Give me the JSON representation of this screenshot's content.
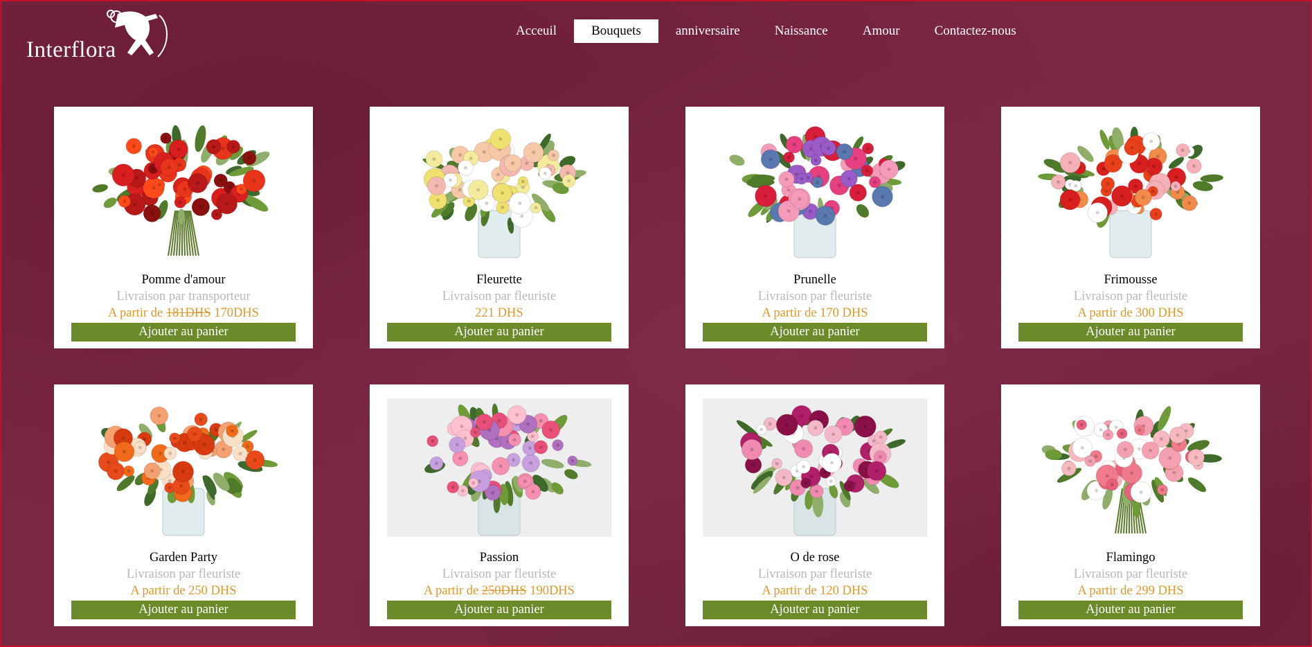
{
  "brand": {
    "logo_text": "Interflora"
  },
  "nav": {
    "items": [
      {
        "label": "Acceuil",
        "active": false
      },
      {
        "label": "Bouquets",
        "active": true
      },
      {
        "label": "anniversaire",
        "active": false
      },
      {
        "label": "Naissance",
        "active": false
      },
      {
        "label": "Amour",
        "active": false
      },
      {
        "label": "Contactez-nous",
        "active": false
      }
    ]
  },
  "colors": {
    "background": "#7a2743",
    "button": "#6b8a2a",
    "price": "#e0982a",
    "delivery": "#b8b8b8"
  },
  "products": [
    {
      "name": "Pomme d'amour",
      "delivery": "Livraison par transporteur",
      "price_prefix": "A partir de",
      "old_price": "181DHS",
      "price": "170DHS",
      "button": "Ajouter au panier",
      "palette": [
        "#d81e1e",
        "#e8341a",
        "#b81818",
        "#ff4a1a",
        "#8a1010"
      ],
      "vase": false
    },
    {
      "name": "Fleurette",
      "delivery": "Livraison par fleuriste",
      "price_prefix": "",
      "old_price": "",
      "price": "221 DHS",
      "button": "Ajouter au panier",
      "palette": [
        "#f4ec9c",
        "#f7c8a8",
        "#f0e070",
        "#ffffff",
        "#f5b8b0"
      ],
      "vase": true
    },
    {
      "name": "Prunelle",
      "delivery": "Livraison par fleuriste",
      "price_prefix": "A partir de",
      "old_price": "",
      "price": "170 DHS",
      "button": "Ajouter au panier",
      "palette": [
        "#e64080",
        "#9a5ac8",
        "#d81e3a",
        "#f59ab8",
        "#5a78b0"
      ],
      "vase": true
    },
    {
      "name": "Frimousse",
      "delivery": "Livraison par fleuriste",
      "price_prefix": "A partir de",
      "old_price": "",
      "price": "300 DHS",
      "button": "Ajouter au panier",
      "palette": [
        "#d81e1e",
        "#f28a4a",
        "#f5b0b8",
        "#e8401a",
        "#ffffff"
      ],
      "vase": true
    },
    {
      "name": "Garden Party",
      "delivery": "Livraison par fleuriste",
      "price_prefix": "A partir de",
      "old_price": "",
      "price": "250 DHS",
      "button": "Ajouter au panier",
      "palette": [
        "#f06a1a",
        "#f5a070",
        "#e84a1a",
        "#fbe0c8",
        "#d83a10"
      ],
      "vase": true
    },
    {
      "name": "Passion",
      "delivery": "Livraison par fleuriste",
      "price_prefix": "A partir de",
      "old_price": "250DHS",
      "price": "190DHS",
      "button": "Ajouter au panier",
      "palette": [
        "#f590b0",
        "#c8a0e0",
        "#e8507a",
        "#ffc0d0",
        "#b070c0"
      ],
      "vase": true
    },
    {
      "name": "O de rose",
      "delivery": "Livraison par fleuriste",
      "price_prefix": "A partir de",
      "old_price": "",
      "price": "120 DHS",
      "button": "Ajouter au panier",
      "palette": [
        "#b0206a",
        "#f5b8c8",
        "#f08ab0",
        "#ffffff",
        "#8a1048"
      ],
      "vase": true
    },
    {
      "name": "Flamingo",
      "delivery": "Livraison par fleuriste",
      "price_prefix": "A partir de",
      "old_price": "",
      "price": "299 DHS",
      "button": "Ajouter au panier",
      "palette": [
        "#f5a0b0",
        "#f07a8a",
        "#ffffff",
        "#f7b8c0",
        "#e8607a"
      ],
      "vase": false
    }
  ]
}
